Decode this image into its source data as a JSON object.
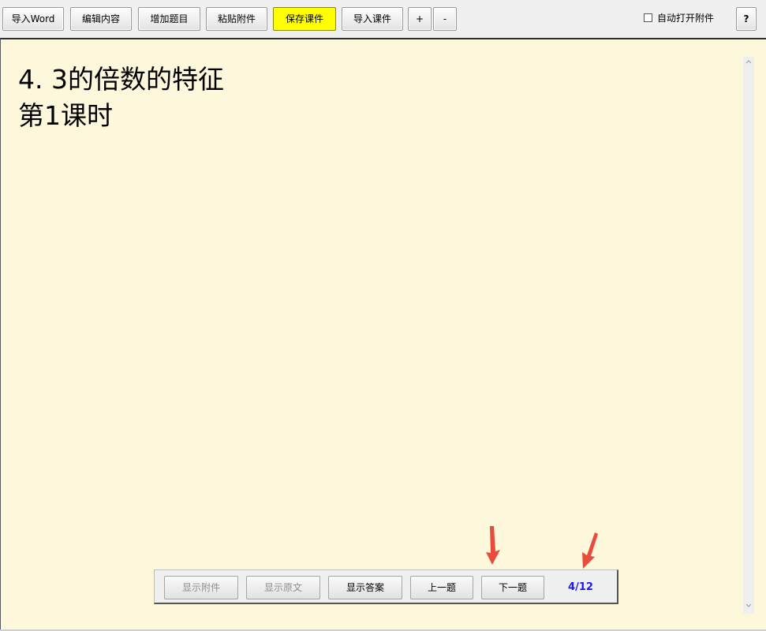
{
  "toolbar": {
    "import_word": "导入Word",
    "edit_content": "编辑内容",
    "add_question": "增加题目",
    "paste_attachment": "粘贴附件",
    "save_courseware": "保存课件",
    "import_courseware": "导入课件",
    "zoom_in": "+",
    "zoom_out": "-",
    "auto_open_label": "自动打开附件",
    "help": "?"
  },
  "content": {
    "line1": "4. 3的倍数的特征",
    "line2": "第1课时"
  },
  "navbar": {
    "show_attachment": "显示附件",
    "show_original": "显示原文",
    "show_answer": "显示答案",
    "prev_question": "上一题",
    "next_question": "下一题",
    "page_indicator": "4/12"
  },
  "colors": {
    "content_bg": "#fdf7dc",
    "save_highlight": "#ffff00",
    "page_indicator": "#1a1aff",
    "annotation_arrow": "#e94b3c"
  }
}
